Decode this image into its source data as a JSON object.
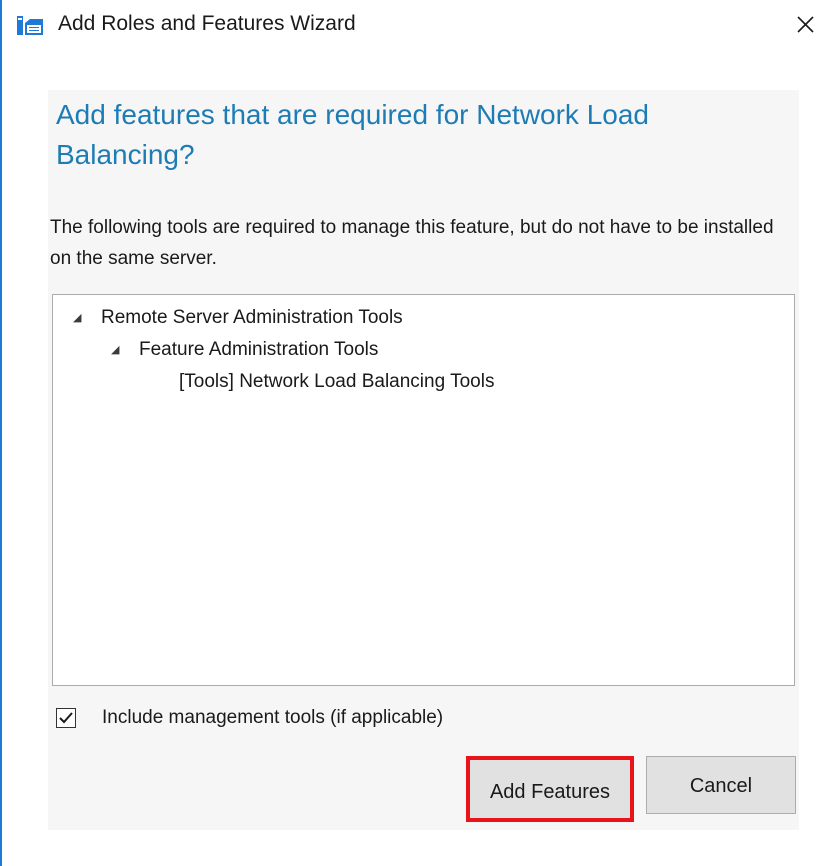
{
  "window": {
    "title": "Add Roles and Features Wizard",
    "close_icon": "close-icon",
    "app_icon": "server-manager-icon"
  },
  "dialog": {
    "heading": "Add features that are required for Network Load Balancing?",
    "description": "The following tools are required to manage this feature, but do not have to be installed on the same server.",
    "tree": [
      {
        "label": "Remote Server Administration Tools",
        "expanded": true,
        "toggle": "◢"
      },
      {
        "label": "Feature Administration Tools",
        "expanded": true,
        "toggle": "◢"
      },
      {
        "label": "[Tools] Network Load Balancing Tools"
      }
    ],
    "include_tools": {
      "label": "Include management tools (if applicable)",
      "checked": true
    },
    "buttons": {
      "add_features": "Add Features",
      "cancel": "Cancel"
    }
  },
  "colors": {
    "heading": "#1e7cb5",
    "highlight_border": "#e8141a",
    "window_accent": "#1e7ad6"
  }
}
